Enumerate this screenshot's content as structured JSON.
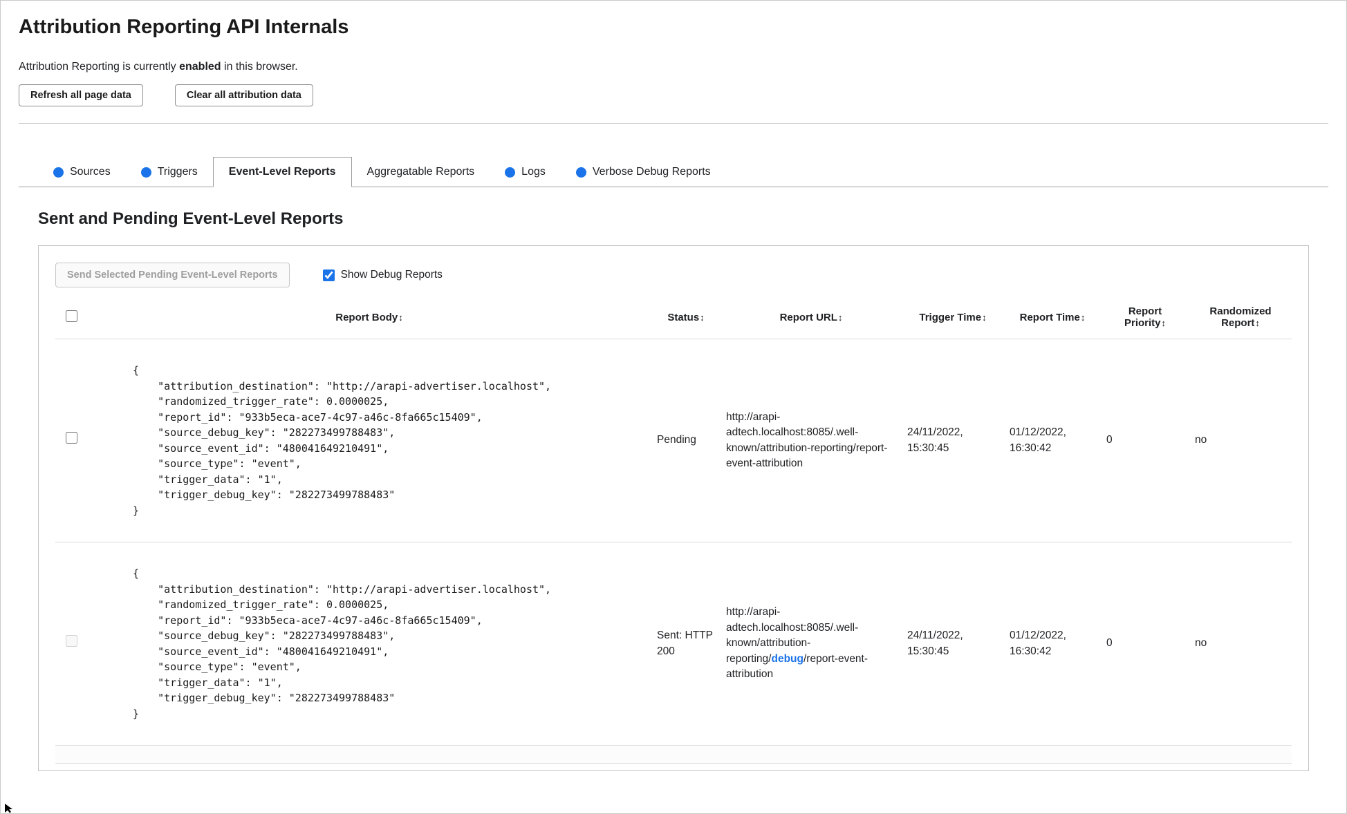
{
  "colors": {
    "accent_blue": "#1a73e8"
  },
  "header": {
    "title": "Attribution Reporting API Internals",
    "status_prefix": "Attribution Reporting is currently ",
    "status_bold": "enabled",
    "status_suffix": " in this browser.",
    "refresh_button": "Refresh all page data",
    "clear_button": "Clear all attribution data"
  },
  "tabs": [
    {
      "label": "Sources",
      "dot": true,
      "active": false
    },
    {
      "label": "Triggers",
      "dot": true,
      "active": false
    },
    {
      "label": "Event-Level Reports",
      "dot": false,
      "active": true
    },
    {
      "label": "Aggregatable Reports",
      "dot": false,
      "active": false
    },
    {
      "label": "Logs",
      "dot": true,
      "active": false
    },
    {
      "label": "Verbose Debug Reports",
      "dot": true,
      "active": false
    }
  ],
  "section": {
    "heading": "Sent and Pending Event-Level Reports"
  },
  "toolbar": {
    "send_label": "Send Selected Pending Event-Level Reports",
    "send_disabled": true,
    "show_debug_label": "Show Debug Reports",
    "show_debug_checked": true
  },
  "table": {
    "select_all_checked": false,
    "sort_icon": "↕",
    "columns": [
      "Report Body",
      "Status",
      "Report URL",
      "Trigger Time",
      "Report Time",
      "Report Priority",
      "Randomized Report"
    ],
    "rows": [
      {
        "selected": false,
        "select_disabled": false,
        "report_body": "{\n    \"attribution_destination\": \"http://arapi-advertiser.localhost\",\n    \"randomized_trigger_rate\": 0.0000025,\n    \"report_id\": \"933b5eca-ace7-4c97-a46c-8fa665c15409\",\n    \"source_debug_key\": \"282273499788483\",\n    \"source_event_id\": \"480041649210491\",\n    \"source_type\": \"event\",\n    \"trigger_data\": \"1\",\n    \"trigger_debug_key\": \"282273499788483\"\n}",
        "status": "Pending",
        "report_url": {
          "prefix": "http://arapi-adtech.localhost:8085/.well-known/attribution-reporting/",
          "highlight": "",
          "suffix": "report-event-attribution"
        },
        "trigger_time": "24/11/2022, 15:30:45",
        "report_time": "01/12/2022, 16:30:42",
        "report_priority": "0",
        "randomized_report": "no"
      },
      {
        "selected": false,
        "select_disabled": true,
        "report_body": "{\n    \"attribution_destination\": \"http://arapi-advertiser.localhost\",\n    \"randomized_trigger_rate\": 0.0000025,\n    \"report_id\": \"933b5eca-ace7-4c97-a46c-8fa665c15409\",\n    \"source_debug_key\": \"282273499788483\",\n    \"source_event_id\": \"480041649210491\",\n    \"source_type\": \"event\",\n    \"trigger_data\": \"1\",\n    \"trigger_debug_key\": \"282273499788483\"\n}",
        "status": "Sent: HTTP 200",
        "report_url": {
          "prefix": "http://arapi-adtech.localhost:8085/.well-known/attribution-reporting/",
          "highlight": "debug",
          "suffix": "/report-event-attribution"
        },
        "trigger_time": "24/11/2022, 15:30:45",
        "report_time": "01/12/2022, 16:30:42",
        "report_priority": "0",
        "randomized_report": "no"
      }
    ]
  }
}
